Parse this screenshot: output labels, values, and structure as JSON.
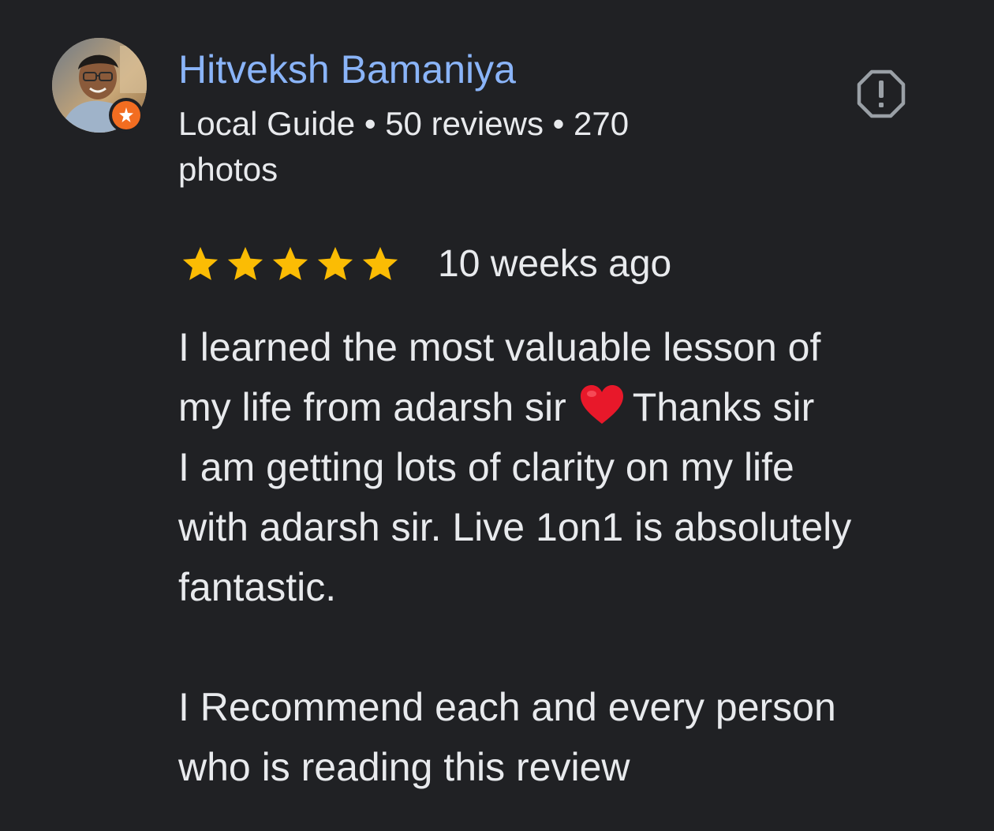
{
  "review": {
    "reviewer": {
      "name": "Hitveksh Bamaniya",
      "meta": "Local Guide • 50 reviews • 270 photos",
      "avatar_icon": "profile-photo",
      "badge_icon": "local-guide-star-icon",
      "badge_color": "#f26d21"
    },
    "report_icon": "report-flag-icon",
    "rating": {
      "stars": 5,
      "max_stars": 5,
      "star_color": "#fbbc04",
      "time_ago": "10 weeks ago"
    },
    "body": {
      "line1": "I learned the most valuable lesson of",
      "line2_before_emoji": "my life from adarsh sir",
      "emoji_icon": "red-heart-emoji",
      "line2_after_emoji": "Thanks sir",
      "line3": "I am getting lots of clarity on my life",
      "line4": "with adarsh sir. Live 1on1 is absolutely",
      "line5": "fantastic.",
      "line6": "I Recommend each and every person",
      "line7": "who is reading this review"
    }
  },
  "colors": {
    "background": "#202124",
    "name": "#8ab4f8",
    "text": "#e8eaed",
    "icon_outline": "#9aa0a6"
  }
}
